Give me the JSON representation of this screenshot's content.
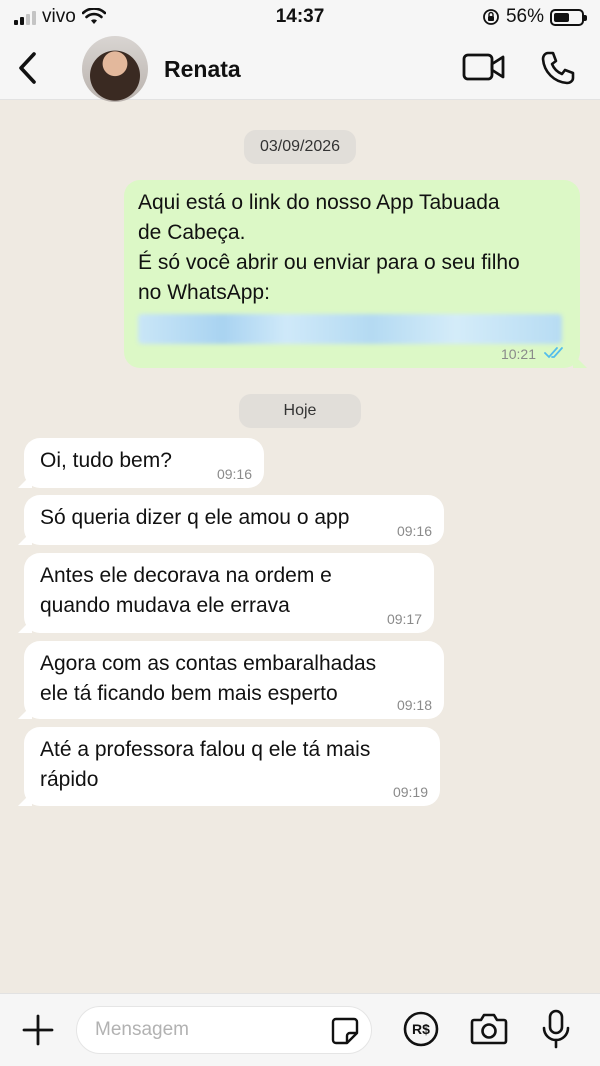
{
  "status_bar": {
    "carrier": "vivo",
    "time": "14:37",
    "battery_percent": "56%",
    "battery_level": 0.56
  },
  "header": {
    "contact_name": "Renata"
  },
  "chat": {
    "date_separators": [
      "03/09/2026",
      "Hoje"
    ],
    "outgoing": {
      "lines": [
        "Aqui está o link do nosso App Tabuada",
        "de Cabeça.",
        "É só você abrir ou enviar para o seu filho",
        "no WhatsApp:"
      ],
      "time": "10:21",
      "status": "read"
    },
    "incoming": [
      {
        "lines": [
          "Oi, tudo bem?"
        ],
        "time": "09:16"
      },
      {
        "lines": [
          "Só queria dizer q ele amou o app"
        ],
        "time": "09:16"
      },
      {
        "lines": [
          "Antes ele decorava na ordem e",
          "quando mudava ele errava"
        ],
        "time": "09:17"
      },
      {
        "lines": [
          "Agora com as contas embaralhadas",
          "ele tá ficando bem mais esperto"
        ],
        "time": "09:18"
      },
      {
        "lines": [
          "Até a professora falou q ele tá mais",
          "rápido"
        ],
        "time": "09:19"
      }
    ]
  },
  "input": {
    "placeholder": "Mensagem"
  },
  "icons": {
    "back": "chevron-left-icon",
    "video": "video-camera-icon",
    "phone": "phone-icon",
    "plus": "plus-icon",
    "sticker": "sticker-icon",
    "payment": "brazilian-real-icon",
    "camera": "camera-icon",
    "mic": "microphone-icon"
  },
  "colors": {
    "chat_background": "#efeae2",
    "outgoing_bubble": "#dcf8c6",
    "incoming_bubble": "#ffffff",
    "read_ticks": "#53bdeb"
  }
}
